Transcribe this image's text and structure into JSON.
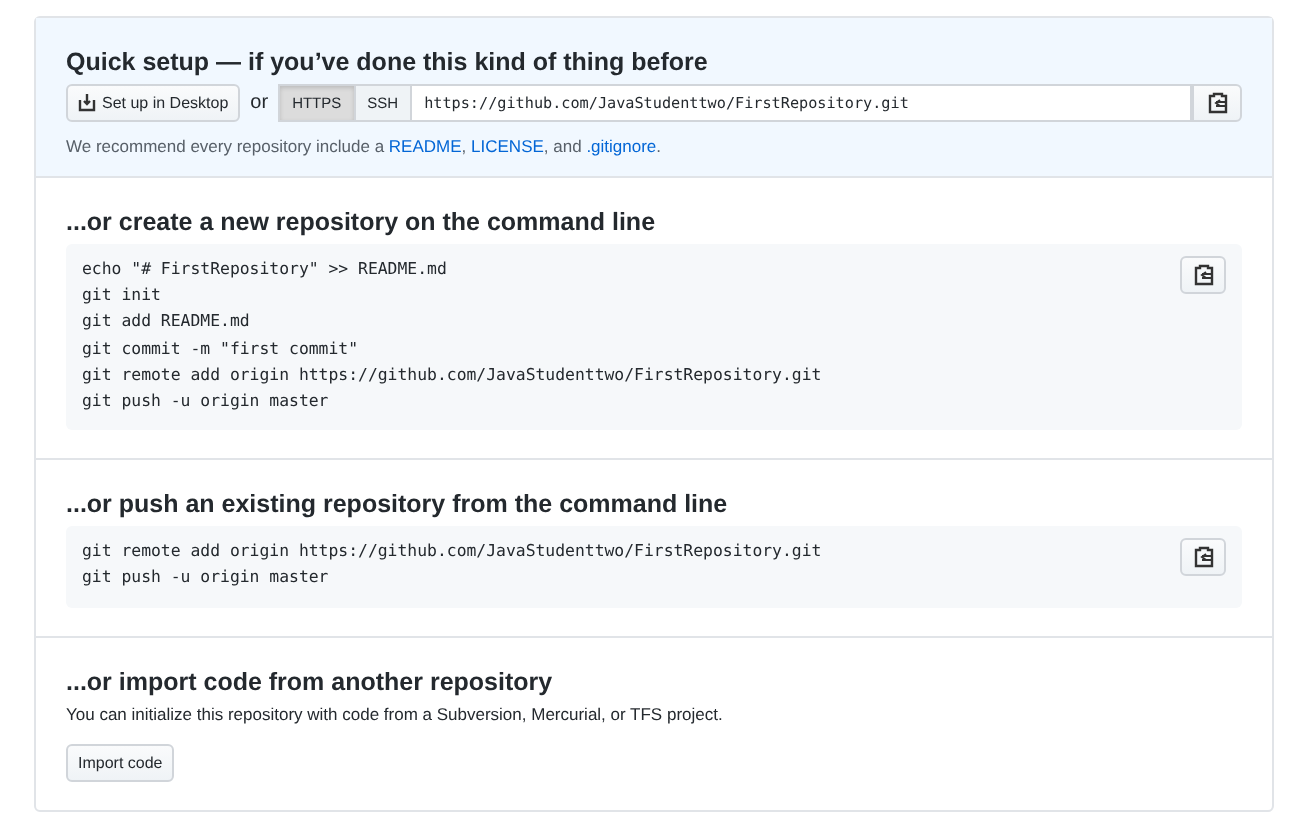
{
  "quick_setup": {
    "title": "Quick setup — if you’ve done this kind of thing before",
    "desktop_button": "Set up in Desktop",
    "or": "or",
    "protocols": [
      {
        "label": "HTTPS",
        "selected": true
      },
      {
        "label": "SSH",
        "selected": false
      }
    ],
    "url": "https://github.com/JavaStudenttwo/FirstRepository.git",
    "recommend": [
      {
        "kind": "text",
        "text": "We recommend every repository include a "
      },
      {
        "kind": "link",
        "text": "README"
      },
      {
        "kind": "text",
        "text": ", "
      },
      {
        "kind": "link",
        "text": "LICENSE"
      },
      {
        "kind": "text",
        "text": ", and "
      },
      {
        "kind": "link",
        "text": ".gitignore"
      },
      {
        "kind": "text",
        "text": "."
      }
    ]
  },
  "sections": [
    {
      "kind": "code",
      "title": "...or create a new repository on the command line",
      "lines": [
        "echo \"# FirstRepository\" >> README.md",
        "git init",
        "git add README.md",
        "git commit -m \"first commit\"",
        "git remote add origin https://github.com/JavaStudenttwo/FirstRepository.git",
        "git push -u origin master"
      ]
    },
    {
      "kind": "code",
      "title": "...or push an existing repository from the command line",
      "lines": [
        "git remote add origin https://github.com/JavaStudenttwo/FirstRepository.git",
        "git push -u origin master"
      ]
    },
    {
      "kind": "import",
      "title": "...or import code from another repository",
      "text": "You can initialize this repository with code from a Subversion, Mercurial, or TFS project.",
      "button": "Import code"
    }
  ]
}
